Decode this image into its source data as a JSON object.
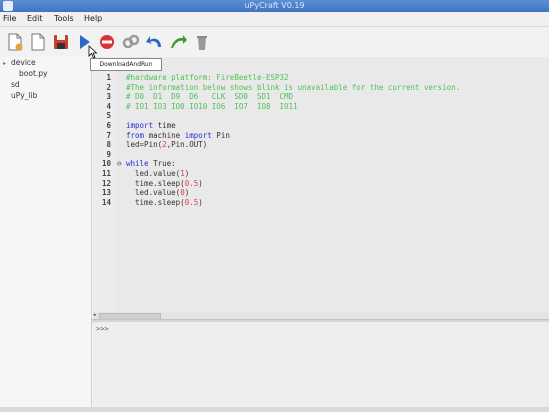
{
  "window": {
    "title": "uPyCraft V0.19"
  },
  "menu": {
    "items": [
      "File",
      "Edit",
      "Tools",
      "Help"
    ]
  },
  "toolbar": {
    "tooltip": "DownloadAndRun"
  },
  "tree": {
    "items": [
      {
        "label": "device",
        "arrow": "▸"
      },
      {
        "label": "boot.py",
        "arrow": ""
      },
      {
        "label": "sd",
        "arrow": ""
      },
      {
        "label": "uPy_lib",
        "arrow": ""
      }
    ]
  },
  "editor": {
    "line_numbers": [
      "1",
      "2",
      "3",
      "4",
      "5",
      "6",
      "7",
      "8",
      "9",
      "10",
      "11",
      "12",
      "13",
      "14"
    ],
    "lines": [
      [
        {
          "t": "#hardware platform: FireBeetle-ESP32",
          "c": "cmt"
        }
      ],
      [
        {
          "t": "#The information below shows blink is unavailable for the current version.",
          "c": "cmt"
        }
      ],
      [
        {
          "t": "# D0  D1  D9  D6   CLK  SD0  SD1  CMD",
          "c": "cmt"
        }
      ],
      [
        {
          "t": "# IO1 IO3 IO0 IO10 IO6  IO7  IO8  IO11",
          "c": "cmt"
        }
      ],
      [],
      [
        {
          "t": "import",
          "c": "kw"
        },
        {
          "t": " time",
          "c": ""
        }
      ],
      [
        {
          "t": "from",
          "c": "kw"
        },
        {
          "t": " machine ",
          "c": ""
        },
        {
          "t": "import",
          "c": "kw"
        },
        {
          "t": " Pin",
          "c": ""
        }
      ],
      [
        {
          "t": "led=Pin(",
          "c": ""
        },
        {
          "t": "2",
          "c": "num"
        },
        {
          "t": ",Pin.OUT)",
          "c": ""
        }
      ],
      [],
      [
        {
          "t": "while",
          "c": "kw"
        },
        {
          "t": " True:",
          "c": ""
        }
      ],
      [
        {
          "t": "  led.value(",
          "c": ""
        },
        {
          "t": "1",
          "c": "num"
        },
        {
          "t": ")",
          "c": ""
        }
      ],
      [
        {
          "t": "  time.sleep(",
          "c": ""
        },
        {
          "t": "0.5",
          "c": "num"
        },
        {
          "t": ")",
          "c": ""
        }
      ],
      [
        {
          "t": "  led.value(",
          "c": ""
        },
        {
          "t": "0",
          "c": "num"
        },
        {
          "t": ")",
          "c": ""
        }
      ],
      [
        {
          "t": "  time.sleep(",
          "c": ""
        },
        {
          "t": "0.5",
          "c": "num"
        },
        {
          "t": ")",
          "c": ""
        }
      ]
    ],
    "fold_marker": "⊖"
  },
  "terminal": {
    "prompt": ">>>"
  }
}
